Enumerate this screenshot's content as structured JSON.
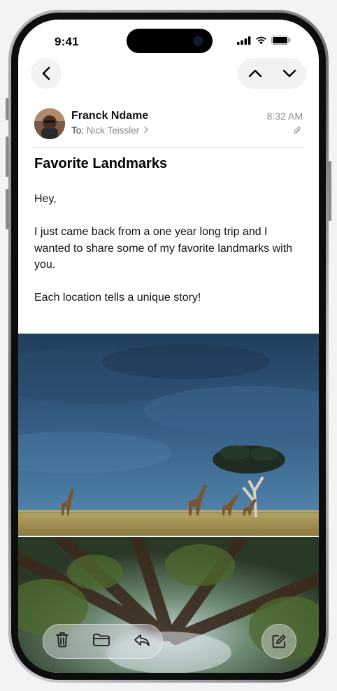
{
  "status_bar": {
    "time": "9:41"
  },
  "email": {
    "sender": "Franck Ndame",
    "to_label": "To:",
    "recipient": "Nick Teissler",
    "time": "8:32 AM",
    "subject": "Favorite Landmarks",
    "greeting": "Hey,",
    "paragraph1": "I just came back from a one year long trip and I wanted to share some of my favorite landmarks with you.",
    "paragraph2": "Each location tells a unique story!"
  },
  "icons": {
    "back": "chevron-left-icon",
    "previous": "chevron-up-icon",
    "next": "chevron-down-icon",
    "attachment": "paperclip-icon",
    "trash": "trash-icon",
    "folder": "folder-icon",
    "reply": "reply-icon",
    "compose": "compose-icon"
  },
  "colors": {
    "accent": "#000000",
    "secondary_text": "#8e8e93"
  }
}
